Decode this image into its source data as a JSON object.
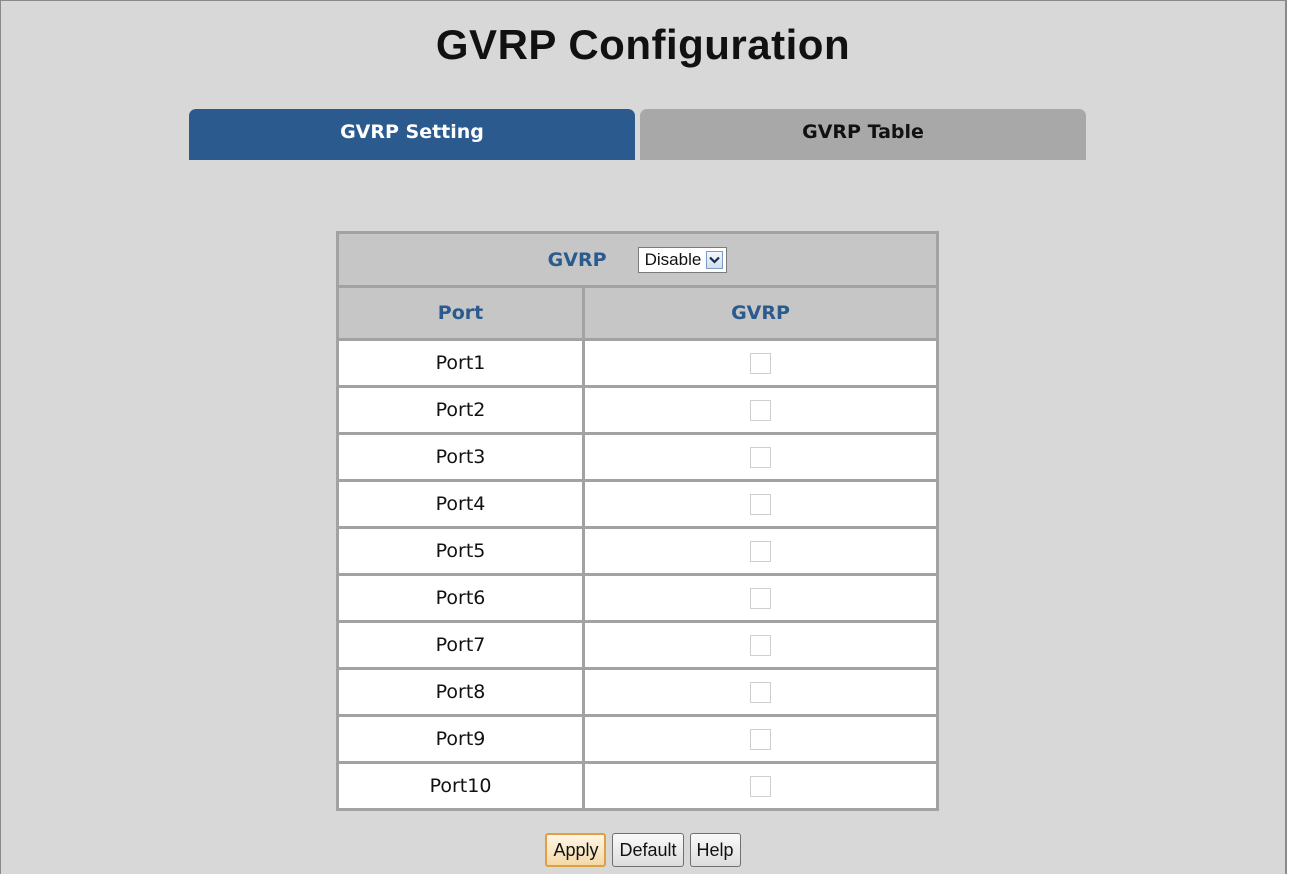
{
  "page": {
    "title": "GVRP Configuration"
  },
  "tabs": [
    {
      "label": "GVRP Setting",
      "active": true
    },
    {
      "label": "GVRP Table",
      "active": false
    }
  ],
  "gvrp": {
    "label": "GVRP",
    "select_value": "Disable",
    "options": [
      "Disable"
    ]
  },
  "table": {
    "headers": [
      "Port",
      "GVRP"
    ],
    "rows": [
      {
        "port": "Port1",
        "checked": false
      },
      {
        "port": "Port2",
        "checked": false
      },
      {
        "port": "Port3",
        "checked": false
      },
      {
        "port": "Port4",
        "checked": false
      },
      {
        "port": "Port5",
        "checked": false
      },
      {
        "port": "Port6",
        "checked": false
      },
      {
        "port": "Port7",
        "checked": false
      },
      {
        "port": "Port8",
        "checked": false
      },
      {
        "port": "Port9",
        "checked": false
      },
      {
        "port": "Port10",
        "checked": false
      }
    ]
  },
  "buttons": {
    "apply": "Apply",
    "default": "Default",
    "help": "Help"
  },
  "colors": {
    "accent": "#2b5a8e",
    "background": "#d8d8d8",
    "tab_inactive": "#a8a8a8",
    "header_cell": "#c6c6c6"
  },
  "icons": {
    "select_arrow": "chevron-down-icon"
  }
}
